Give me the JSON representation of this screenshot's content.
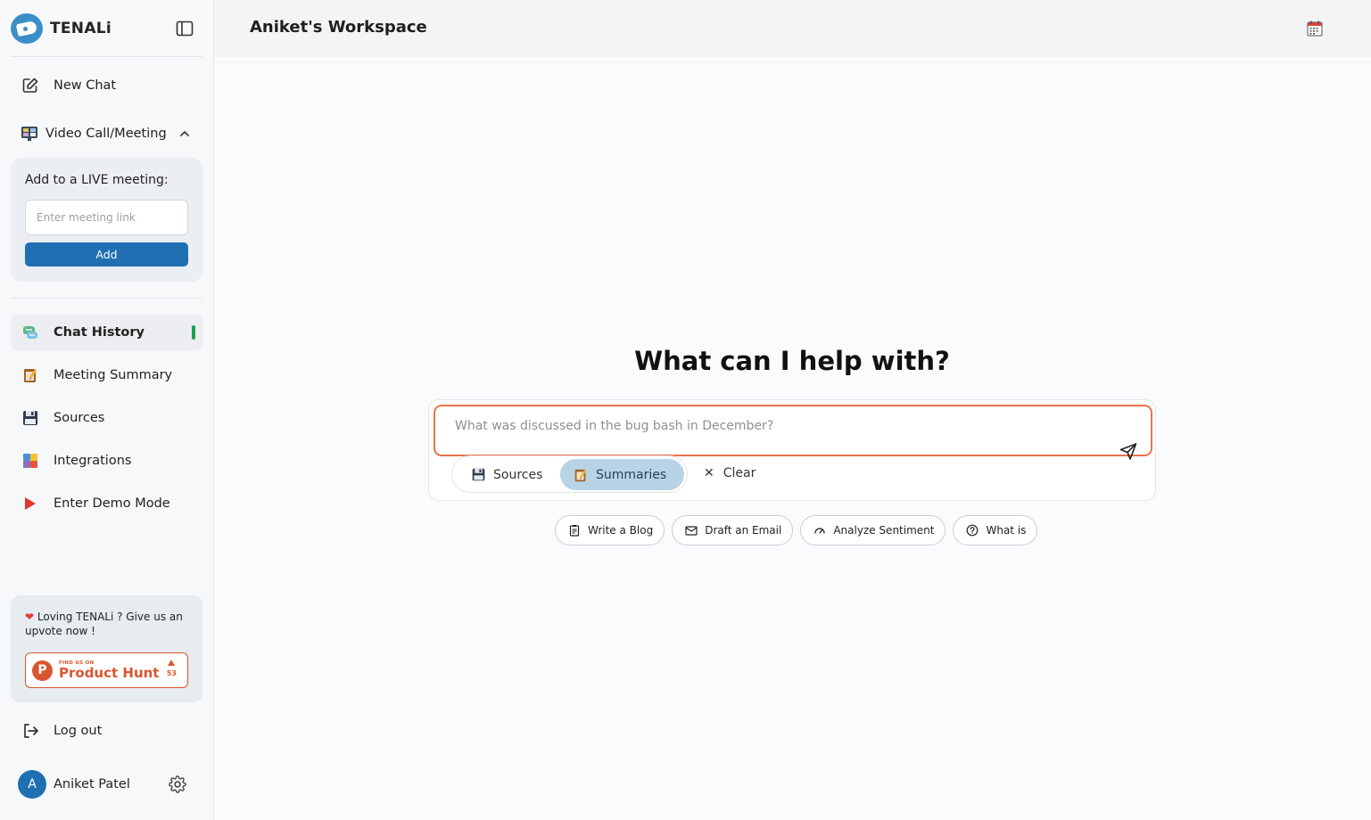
{
  "brand": {
    "name": "TENALi"
  },
  "sidebar": {
    "new_chat": "New Chat",
    "video_call": "Video Call/Meeting",
    "meeting_card": {
      "label": "Add to a LIVE meeting:",
      "input_placeholder": "Enter meeting link",
      "add_button": "Add"
    },
    "items": [
      {
        "label": "Chat History",
        "icon": "chat-history-icon",
        "active": true
      },
      {
        "label": "Meeting Summary",
        "icon": "notepad-icon"
      },
      {
        "label": "Sources",
        "icon": "floppy-disk-icon"
      },
      {
        "label": "Integrations",
        "icon": "integrations-icon"
      },
      {
        "label": "Enter Demo Mode",
        "icon": "play-icon"
      }
    ],
    "promo": {
      "text": "Loving TENALi ? Give us an upvote now !",
      "badge_small": "FIND US ON",
      "badge_big": "Product Hunt",
      "votes": "53"
    },
    "logout": "Log out",
    "user": {
      "name": "Aniket Patel",
      "initial": "A"
    }
  },
  "header": {
    "workspace_title": "Aniket's Workspace"
  },
  "main": {
    "hero_title": "What can I help with?",
    "input_placeholder": "What was discussed in the bug bash in December?",
    "toggles": {
      "sources": "Sources",
      "summaries": "Summaries"
    },
    "clear": "Clear",
    "chips": [
      "Write a Blog",
      "Draft an Email",
      "Analyze Sentiment",
      "What is"
    ]
  },
  "colors": {
    "accent_blue": "#1f6fb2",
    "active_indicator": "#1f9d55",
    "input_border": "#e8734a",
    "summaries_bg": "#b9d3e6",
    "product_hunt": "#da552f"
  }
}
